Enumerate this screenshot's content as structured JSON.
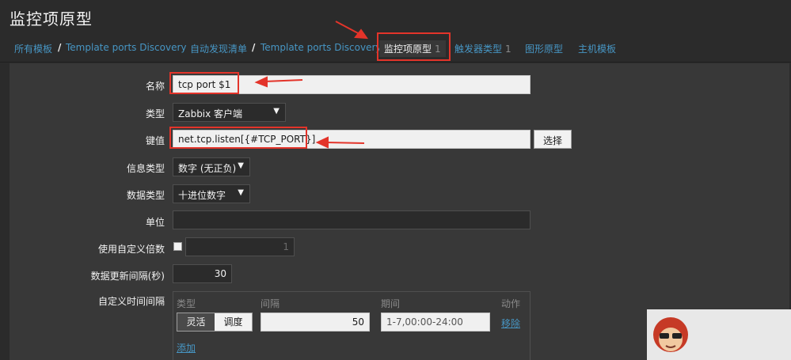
{
  "page": {
    "title": "监控项原型"
  },
  "breadcrumb": {
    "all_templates": "所有模板",
    "template_1": "Template ports Discovery",
    "discovery_rules": "自动发现清单",
    "template_2": "Template ports Discovery",
    "separator": "/"
  },
  "tabs": [
    {
      "label": "监控项原型",
      "count": "1"
    },
    {
      "label": "触发器类型",
      "count": "1"
    },
    {
      "label": "图形原型"
    },
    {
      "label": "主机模板"
    }
  ],
  "form": {
    "name": {
      "label": "名称",
      "value": "tcp port $1"
    },
    "type": {
      "label": "类型",
      "value": "Zabbix 客户端"
    },
    "key": {
      "label": "键值",
      "value": "net.tcp.listen[{#TCP_PORT}]",
      "select_button": "选择"
    },
    "info_type": {
      "label": "信息类型",
      "value": "数字 (无正负)"
    },
    "data_type": {
      "label": "数据类型",
      "value": "十进位数字"
    },
    "units": {
      "label": "单位",
      "value": ""
    },
    "custom_multiplier": {
      "label": "使用自定义倍数",
      "value": "1",
      "checked": false
    },
    "update_interval": {
      "label": "数据更新间隔(秒)",
      "value": "30"
    },
    "custom_intervals": {
      "label": "自定义时间间隔",
      "headers": {
        "type": "类型",
        "interval": "间隔",
        "period": "期间",
        "action": "动作"
      },
      "type_flexible": "灵活",
      "type_scheduling": "调度",
      "interval_value": "50",
      "period_value": "1-7,00:00-24:00",
      "remove": "移除",
      "add": "添加"
    }
  },
  "colors": {
    "accent": "#4796c4",
    "annotation": "#e3342a",
    "background": "#2b2b2b",
    "panel": "#383838"
  }
}
